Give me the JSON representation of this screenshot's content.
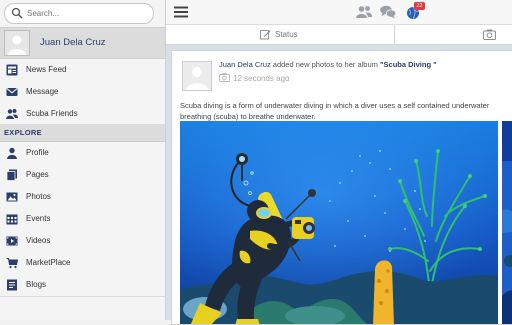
{
  "search": {
    "placeholder": "Search..."
  },
  "user": {
    "name": "Juan Dela Cruz"
  },
  "nav_top": [
    {
      "label": "News Feed",
      "icon": "news-feed-icon"
    },
    {
      "label": "Message",
      "icon": "message-icon"
    },
    {
      "label": "Scuba Friends",
      "icon": "friends-icon"
    }
  ],
  "section_label": "EXPLORE",
  "nav_explore": [
    {
      "label": "Profile",
      "icon": "profile-icon"
    },
    {
      "label": "Pages",
      "icon": "pages-icon"
    },
    {
      "label": "Photos",
      "icon": "photos-icon"
    },
    {
      "label": "Events",
      "icon": "events-icon"
    },
    {
      "label": "Videos",
      "icon": "videos-icon"
    },
    {
      "label": "MarketPlace",
      "icon": "cart-icon"
    },
    {
      "label": "Blogs",
      "icon": "blogs-icon"
    }
  ],
  "topbar": {
    "notification_count": "22"
  },
  "tabs": {
    "status": "Status"
  },
  "post": {
    "author": "Juan Dela Cruz",
    "action": "added new photos to her album",
    "album": "\"Scuba Diving \"",
    "time": "12 seconds ago",
    "text": "Scuba diving is a form of underwater diving in which a diver uses a self contained underwater breathing (scuba) to breathe underwater."
  },
  "colors": {
    "accent": "#2c3e6b",
    "badge": "#e23b3b",
    "ocean": "#1e5bc8"
  }
}
